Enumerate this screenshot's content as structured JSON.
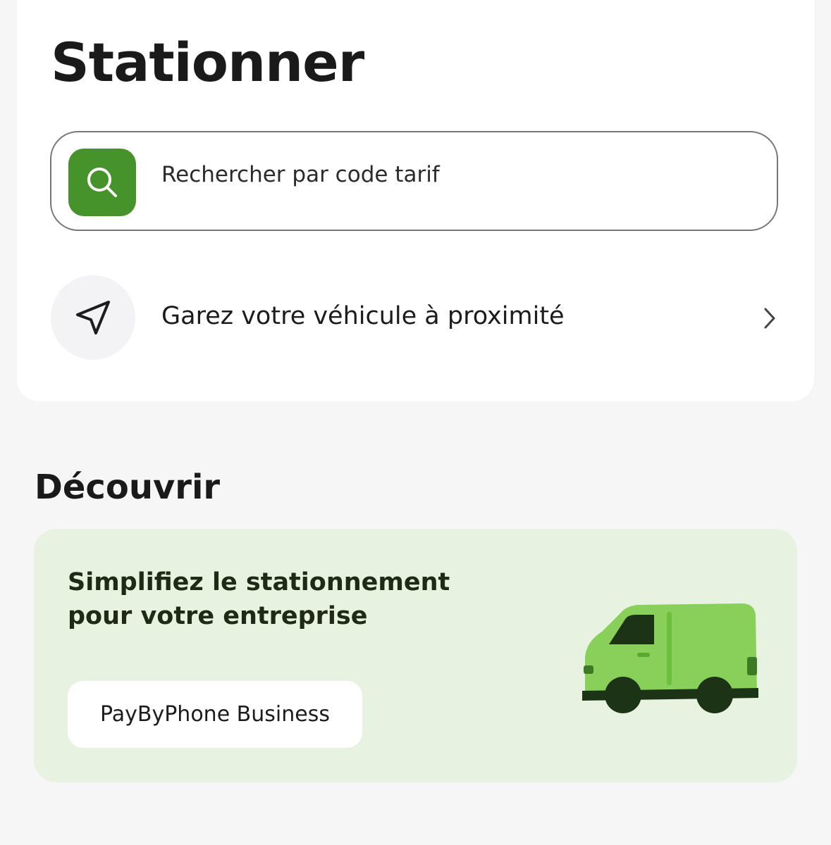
{
  "park": {
    "title": "Stationner",
    "search": {
      "placeholder": "Rechercher par code tarif",
      "icon": "search-icon",
      "accent_color": "#46932c"
    },
    "nearby": {
      "label": "Garez votre véhicule à proximité",
      "icon": "navigation-arrow-icon",
      "trailing_icon": "chevron-right-icon"
    }
  },
  "discover": {
    "title": "Découvrir",
    "promo": {
      "text": "Simplifiez le stationnement pour votre entreprise",
      "button_label": "PayByPhone Business",
      "illustration": "van-illustration",
      "background_color": "#e8f2e1"
    }
  }
}
